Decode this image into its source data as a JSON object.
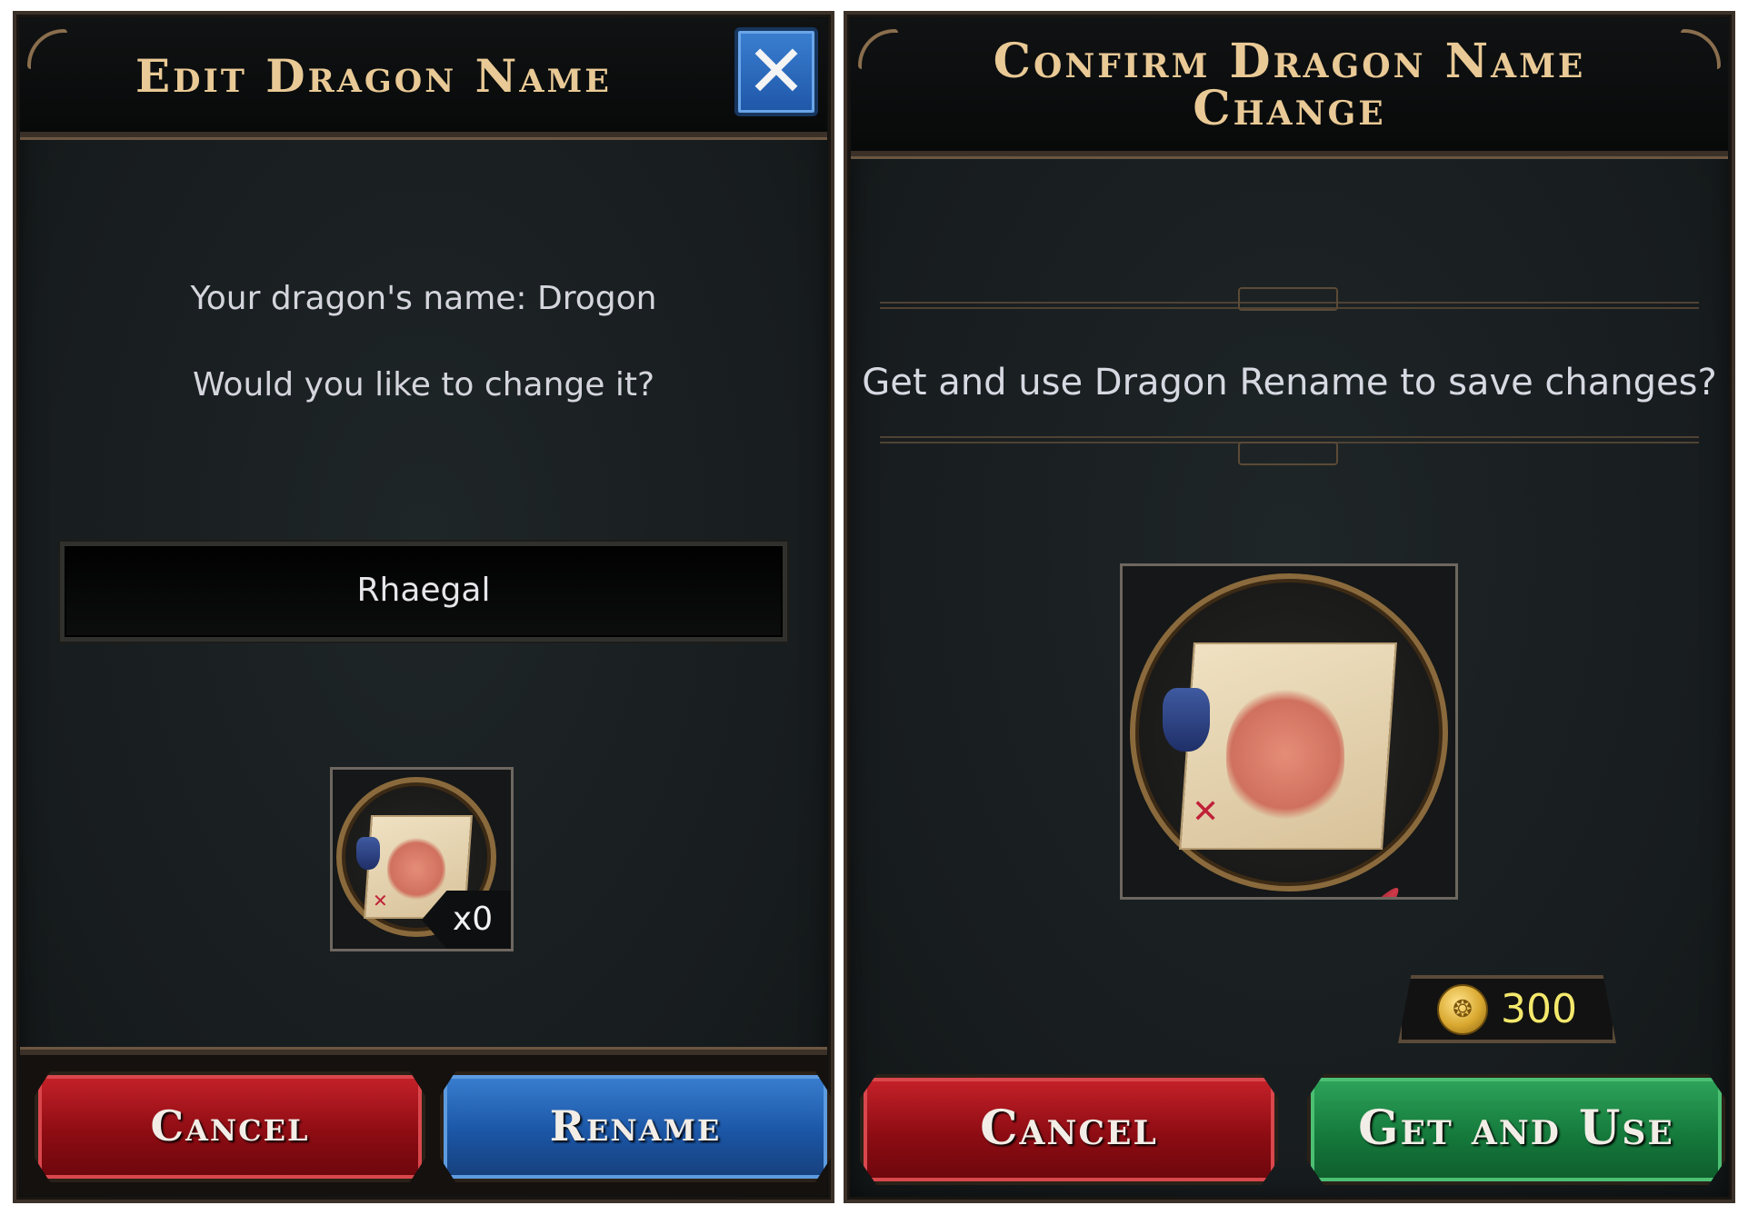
{
  "edit_dialog": {
    "title": "Edit Dragon Name",
    "close_icon": "close-x-icon",
    "current_name_line": "Your dragon's name: Drogon",
    "prompt_line": "Would you like to change it?",
    "name_input_value": "Rhaegal",
    "item": {
      "icon": "quill-scroll-icon",
      "count": "x0"
    },
    "buttons": {
      "cancel": "Cancel",
      "rename": "Rename"
    }
  },
  "confirm_dialog": {
    "title": "Confirm Dragon Name Change",
    "message": "Get and use Dragon Rename to save changes?",
    "item": {
      "icon": "quill-scroll-icon"
    },
    "price": {
      "icon": "gold-coin-icon",
      "amount": "300"
    },
    "buttons": {
      "cancel": "Cancel",
      "get_and_use": "Get and Use"
    }
  },
  "colors": {
    "title_gold": "#e9c995",
    "cancel_red": "#b5141c",
    "rename_blue": "#2a6cc0",
    "confirm_green": "#1f8d48",
    "price_yellow": "#f4e86c"
  }
}
